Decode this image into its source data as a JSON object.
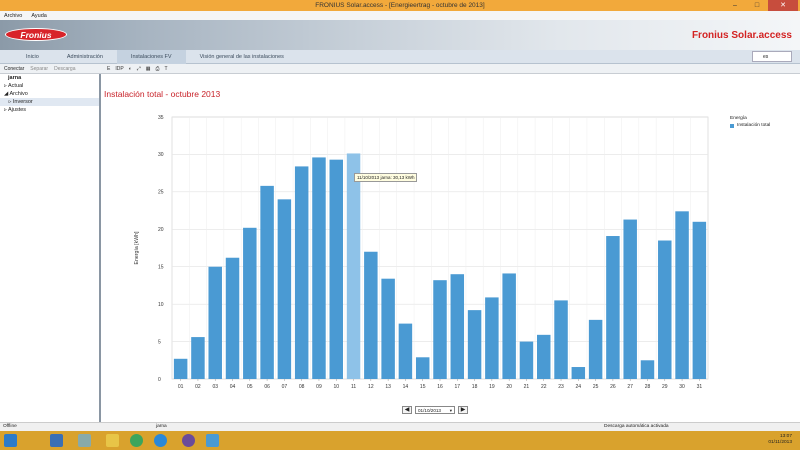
{
  "window": {
    "title": "FRONIUS Solar.access - [Energieertrag - octubre de 2013]",
    "minimize": "–",
    "maximize": "□",
    "close": "✕"
  },
  "menu": [
    "Archivo",
    "Ayuda"
  ],
  "banner": {
    "logo": "Fronius",
    "brand": "Fronius Solar.access"
  },
  "nav_tabs": [
    "Inicio",
    "Administración",
    "Instalaciones FV",
    "Visión general de las instalaciones"
  ],
  "language": "es",
  "toolbar": {
    "connect": "Conectar",
    "separate": "Separar",
    "download": "Descarga"
  },
  "chart_toolbar": [
    "E",
    "IDP",
    "◐",
    "⤢",
    "▦",
    "⎙",
    "T"
  ],
  "tree": {
    "root": "jarna",
    "items": [
      "Actual",
      "Archivo",
      "Inversor",
      "Ajustes"
    ]
  },
  "chart_title": "Instalación total - octubre 2013",
  "tooltip": "11/10/2013 jarna: 30,13 kWh",
  "date_selector": "01/10/2013",
  "status": {
    "left": "Offline",
    "mid": "jarna",
    "right": "Descarga automática activada"
  },
  "clock": {
    "time": "13:07",
    "date": "01/11/2013"
  },
  "colors": {
    "accent": "#c8232a",
    "bar": "#4a9ad3",
    "bar_hover": "#8ec2e8"
  },
  "chart_data": {
    "type": "bar",
    "categories": [
      "01",
      "02",
      "03",
      "04",
      "05",
      "06",
      "07",
      "08",
      "09",
      "10",
      "11",
      "12",
      "13",
      "14",
      "15",
      "16",
      "17",
      "18",
      "19",
      "20",
      "21",
      "22",
      "23",
      "24",
      "25",
      "26",
      "27",
      "28",
      "29",
      "30",
      "31"
    ],
    "series": [
      {
        "name": "Instalación total",
        "values": [
          2.7,
          5.6,
          15.0,
          16.2,
          20.2,
          25.8,
          24.0,
          28.4,
          29.6,
          29.3,
          30.13,
          17.0,
          13.4,
          7.4,
          2.9,
          13.2,
          14.0,
          9.2,
          10.9,
          14.1,
          5.0,
          5.9,
          10.5,
          1.6,
          7.9,
          19.1,
          21.3,
          2.5,
          18.5,
          22.4,
          21.0
        ]
      }
    ],
    "legend_title": "Energía",
    "ylabel": "Energía [kWh]",
    "xlabel": "",
    "ylim": [
      0,
      35
    ],
    "yticks": [
      0,
      5,
      10,
      15,
      20,
      25,
      30,
      35
    ],
    "highlight_index": 10,
    "grid": true,
    "legend": "top-right"
  }
}
